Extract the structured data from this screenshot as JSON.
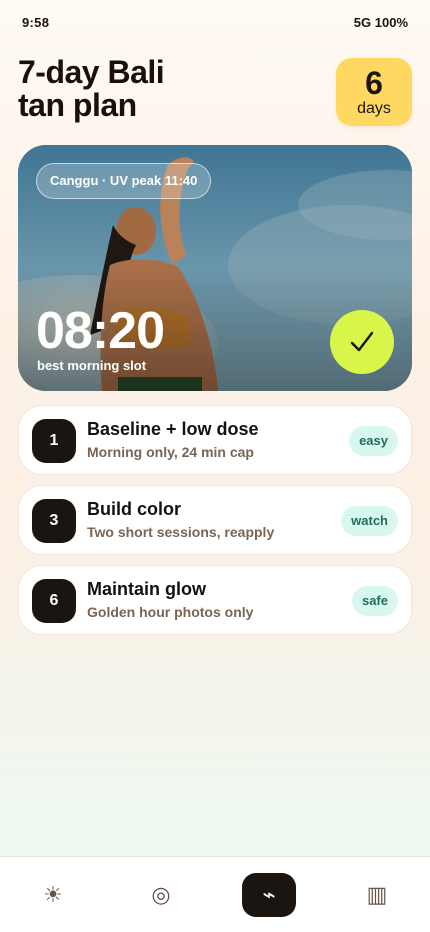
{
  "status_bar": {
    "time": "9:58",
    "network": "5G 100%"
  },
  "header": {
    "title_line1": "7-day Bali",
    "title_line2": "tan plan",
    "days_count": "6",
    "days_label": "days"
  },
  "hero": {
    "location_chip": "Canggu · UV peak 11:40",
    "time": "08:20",
    "caption": "best morning slot",
    "confirm_icon": "check-icon"
  },
  "plan": [
    {
      "step": "1",
      "title": "Baseline + low dose",
      "subtitle": "Morning only, 24 min cap",
      "tag": "easy"
    },
    {
      "step": "3",
      "title": "Build color",
      "subtitle": "Two short sessions, reapply",
      "tag": "watch"
    },
    {
      "step": "6",
      "title": "Maintain glow",
      "subtitle": "Golden hour photos only",
      "tag": "safe"
    }
  ],
  "nav": {
    "items": [
      {
        "icon": "sun-icon",
        "glyph": "☀",
        "active": false
      },
      {
        "icon": "target-icon",
        "glyph": "◎",
        "active": false
      },
      {
        "icon": "bolt-icon",
        "glyph": "⌁",
        "active": true
      },
      {
        "icon": "barcode-icon",
        "glyph": "▥",
        "active": false
      }
    ]
  },
  "colors": {
    "accent_yellow": "#ffd861",
    "confirm_lime": "#d8f64a",
    "tag_mint": "#d8f7ef",
    "dark": "#1b1512"
  }
}
